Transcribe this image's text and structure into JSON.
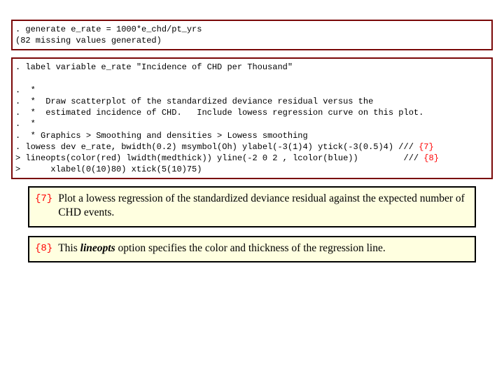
{
  "code1": ". generate e_rate = 1000*e_chd/pt_yrs\n(82 missing values generated)",
  "code2_prefix": ". label variable e_rate \"Incidence of CHD per Thousand\"\n\n.  *\n.  *  Draw scatterplot of the standardized deviance residual versus the\n.  *  estimated incidence of CHD.   Include lowess regression curve on this plot.\n.  *\n.  * Graphics > Smoothing and densities > Lowess smoothing\n. lowess dev e_rate, bwidth(0.2) msymbol(Oh) ylabel(-3(1)4) ytick(-3(0.5)4) ///",
  "code2_tag7": " {7}",
  "code2_line2a": "> lineopts(color(red) lwidth(medthick)) yline(-2 0 2 , lcolor(blue))         ///",
  "code2_tag8": " {8}",
  "code2_line3": ">      xlabel(0(10)80) xtick(5(10)75)",
  "note7": {
    "tag": "{7}",
    "text": "Plot a lowess regression of the standardized deviance residual against the expected number of CHD events."
  },
  "note8": {
    "tag": "{8}",
    "textPrefix": "This ",
    "textEm": "lineopts",
    "textSuffix": " option specifies the color and thickness of the regression line."
  }
}
